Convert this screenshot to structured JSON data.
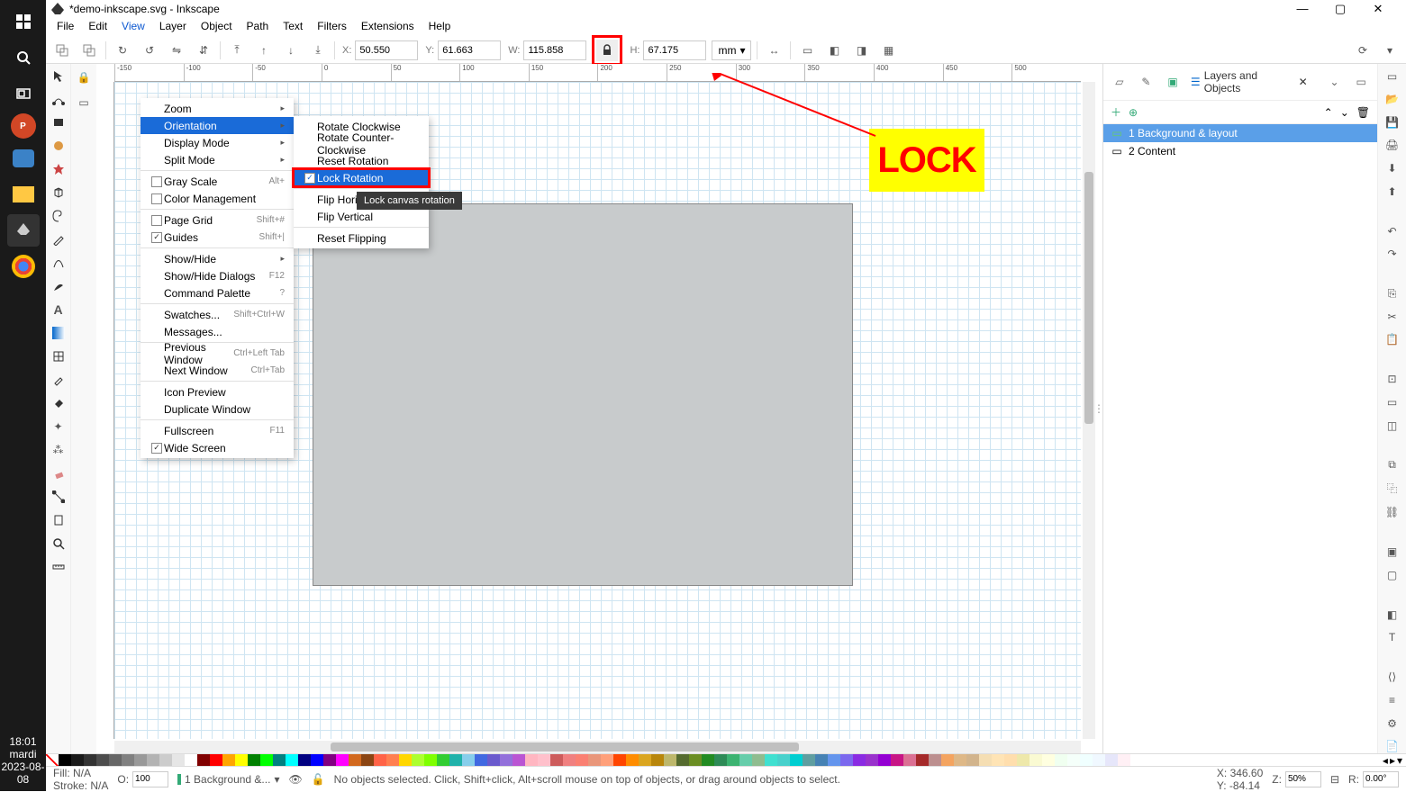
{
  "taskbar": {
    "time": "18:01",
    "day": "mardi",
    "date": "2023-08-08"
  },
  "window": {
    "title": "*demo-inkscape.svg - Inkscape"
  },
  "menubar": [
    "File",
    "Edit",
    "View",
    "Layer",
    "Object",
    "Path",
    "Text",
    "Filters",
    "Extensions",
    "Help"
  ],
  "toolbar": {
    "x_label": "X:",
    "x": "50.550",
    "y_label": "Y:",
    "y": "61.663",
    "w_label": "W:",
    "w": "115.858",
    "h_label": "H:",
    "h": "67.175",
    "unit": "mm"
  },
  "annotation": {
    "lock": "LOCK"
  },
  "view_menu": {
    "items": [
      {
        "label": "Zoom",
        "arrow": true
      },
      {
        "label": "Orientation",
        "arrow": true,
        "hl": true
      },
      {
        "label": "Display Mode",
        "arrow": true
      },
      {
        "label": "Split Mode",
        "arrow": true
      },
      {
        "label": "Gray Scale",
        "sc": "Alt+",
        "cb": true
      },
      {
        "label": "Color Management",
        "cb": true
      },
      {
        "label": "Page Grid",
        "sc": "Shift+#",
        "cb": true
      },
      {
        "label": "Guides",
        "sc": "Shift+|",
        "cb": true,
        "checked": true
      },
      {
        "label": "Show/Hide",
        "arrow": true
      },
      {
        "label": "Show/Hide Dialogs",
        "sc": "F12"
      },
      {
        "label": "Command Palette",
        "sc": "?"
      },
      {
        "label": "Swatches...",
        "sc": "Shift+Ctrl+W"
      },
      {
        "label": "Messages..."
      },
      {
        "label": "Previous Window",
        "sc": "Ctrl+Left Tab"
      },
      {
        "label": "Next Window",
        "sc": "Ctrl+Tab"
      },
      {
        "label": "Icon Preview"
      },
      {
        "label": "Duplicate Window"
      },
      {
        "label": "Fullscreen",
        "sc": "F11"
      },
      {
        "label": "Wide Screen",
        "cb": true,
        "checked": true
      }
    ]
  },
  "submenu": {
    "items": [
      {
        "label": "Rotate Clockwise"
      },
      {
        "label": "Rotate Counter-Clockwise"
      },
      {
        "label": "Reset Rotation"
      },
      {
        "label": "Lock Rotation",
        "cb": true,
        "checked": true,
        "hl": true,
        "boxed": true
      },
      {
        "label": "Flip Horizontal"
      },
      {
        "label": "Flip Vertical"
      },
      {
        "label": "Reset Flipping"
      }
    ]
  },
  "tooltip": "Lock canvas rotation",
  "panel": {
    "tab_label": "Layers and Objects",
    "layers": [
      {
        "name": "1 Background & layout",
        "sel": true
      },
      {
        "name": "2 Content"
      }
    ]
  },
  "ruler_h": [
    "-150",
    "-100",
    "-50",
    "0",
    "50",
    "100",
    "150",
    "200",
    "250",
    "300",
    "350",
    "400",
    "450",
    "500"
  ],
  "status": {
    "fill_label": "Fill:",
    "fill": "N/A",
    "stroke_label": "Stroke:",
    "stroke": "N/A",
    "opacity_label": "O:",
    "opacity": "100",
    "layer": "1 Background &...",
    "msg": "No objects selected. Click, Shift+click, Alt+scroll mouse on top of objects, or drag around objects to select.",
    "x_label": "X:",
    "x": "346.60",
    "y_label": "Y:",
    "y": "-84.14",
    "zoom_label": "Z:",
    "zoom": "50%",
    "rot_label": "R:",
    "rot": "0.00°"
  },
  "palette": [
    "#000000",
    "#1a1a1a",
    "#333333",
    "#4d4d4d",
    "#666666",
    "#808080",
    "#999999",
    "#b3b3b3",
    "#cccccc",
    "#e6e6e6",
    "#ffffff",
    "#800000",
    "#ff0000",
    "#ffa500",
    "#ffff00",
    "#008000",
    "#00ff00",
    "#008080",
    "#00ffff",
    "#000080",
    "#0000ff",
    "#800080",
    "#ff00ff",
    "#d2691e",
    "#8b4513",
    "#ff6347",
    "#ff7f50",
    "#ffd700",
    "#adff2f",
    "#7fff00",
    "#32cd32",
    "#20b2aa",
    "#87ceeb",
    "#4169e1",
    "#6a5acd",
    "#9370db",
    "#ba55d3",
    "#ffb6c1",
    "#ffc0cb",
    "#cd5c5c",
    "#f08080",
    "#fa8072",
    "#e9967a",
    "#ffa07a",
    "#ff4500",
    "#ff8c00",
    "#daa520",
    "#b8860b",
    "#bdb76b",
    "#556b2f",
    "#6b8e23",
    "#228b22",
    "#2e8b57",
    "#3cb371",
    "#66cdaa",
    "#8fbc8f",
    "#40e0d0",
    "#48d1cc",
    "#00ced1",
    "#5f9ea0",
    "#4682b4",
    "#6495ed",
    "#7b68ee",
    "#8a2be2",
    "#9932cc",
    "#9400d3",
    "#c71585",
    "#db7093",
    "#a52a2a",
    "#bc8f8f",
    "#f4a460",
    "#deb887",
    "#d2b48c",
    "#f5deb3",
    "#ffe4b5",
    "#ffdead",
    "#eee8aa",
    "#fafad2",
    "#ffffe0",
    "#f0fff0",
    "#f5fffa",
    "#f0ffff",
    "#f0f8ff",
    "#e6e6fa",
    "#fff0f5"
  ]
}
